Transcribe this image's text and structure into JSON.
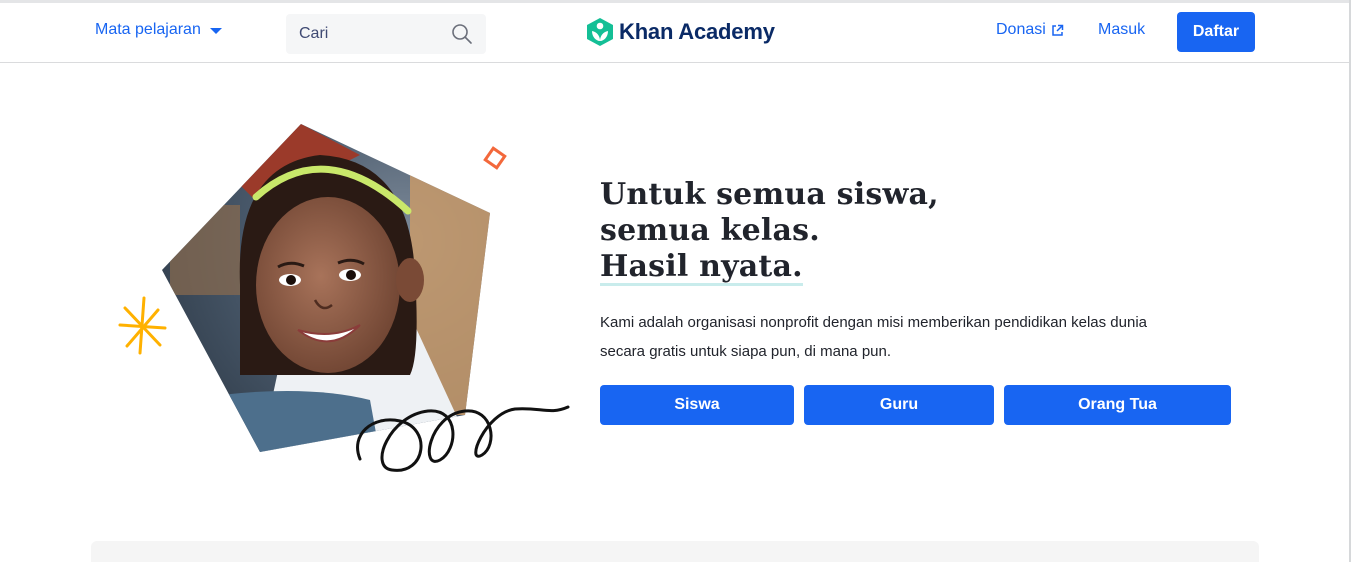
{
  "header": {
    "subjects_label": "Mata pelajaran",
    "search_placeholder": "Cari",
    "brand_name": "Khan Academy",
    "donate_label": "Donasi",
    "login_label": "Masuk",
    "signup_label": "Daftar"
  },
  "hero": {
    "headline_line1": "Untuk semua siswa,",
    "headline_line2": "semua kelas.",
    "headline_line3": "Hasil nyata.",
    "description": "Kami adalah organisasi nonprofit dengan misi memberikan pendidikan kelas dunia secara gratis untuk siapa pun, di mana pun.",
    "buttons": [
      {
        "label": "Siswa"
      },
      {
        "label": "Guru"
      },
      {
        "label": "Orang Tua"
      }
    ]
  },
  "icons": {
    "subjects_dropdown": "caret-down-icon",
    "search": "search-icon",
    "brand": "khan-academy-logo-icon",
    "donate_external": "external-link-icon",
    "hero_star": "sparkle-icon",
    "hero_diamond": "diamond-outline-icon",
    "hero_squiggle": "squiggle-icon"
  },
  "colors": {
    "primary": "#1865f2",
    "brand_text": "#0a2a66",
    "brand_green": "#14bf96",
    "accent_orange": "#f3683b",
    "accent_yellow": "#ffb100",
    "text": "#21242c"
  }
}
